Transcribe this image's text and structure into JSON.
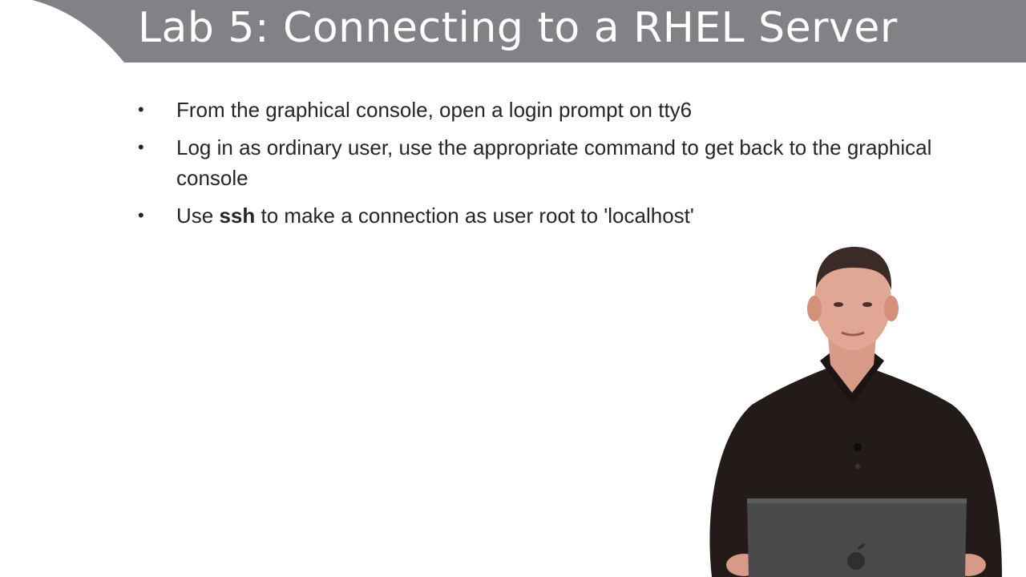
{
  "slide": {
    "title": "Lab 5: Connecting to a RHEL Server",
    "bullets": [
      {
        "text": "From the graphical console, open a login prompt on tty6"
      },
      {
        "text": "Log in as ordinary user, use the appropriate command to get back to the graphical console"
      },
      {
        "prefix": "Use ",
        "bold": "ssh",
        "suffix": " to make a connection as user root to 'localhost'"
      }
    ],
    "bullet_glyph": "•"
  },
  "colors": {
    "banner": "#808285",
    "banner_accent": "#d9d9da",
    "title_text": "#ffffff",
    "body_text": "#262626",
    "shirt": "#231b1a",
    "laptop": "#4a4a4c"
  },
  "presenter": {
    "icon": "presenter-video-icon"
  }
}
